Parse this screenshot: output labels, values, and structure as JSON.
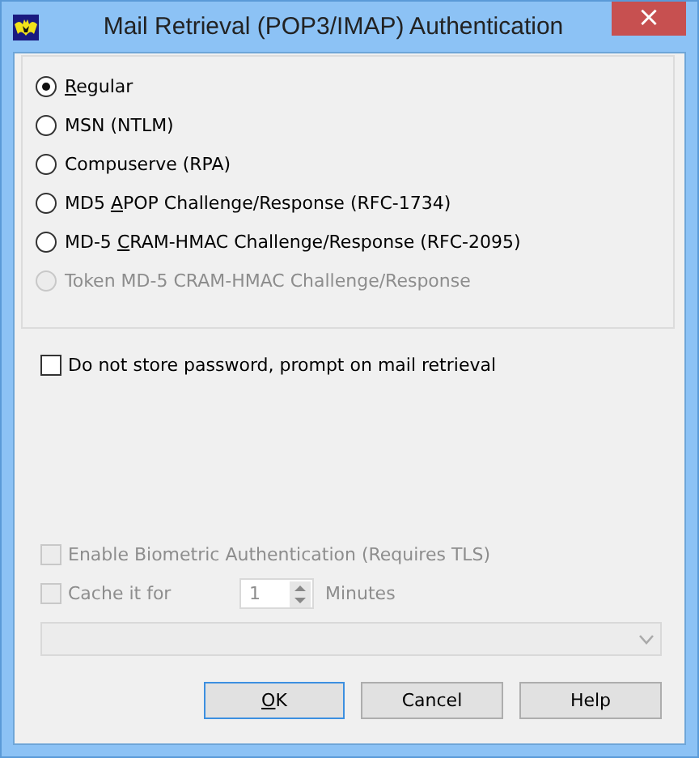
{
  "window": {
    "title": "Mail Retrieval (POP3/IMAP) Authentication",
    "close": "×"
  },
  "methods": [
    {
      "key": "R",
      "after": "egular",
      "selected": true,
      "disabled": false
    },
    {
      "before": "MSN (NTLM)",
      "selected": false,
      "disabled": false
    },
    {
      "before": "Compuserve (RPA)",
      "selected": false,
      "disabled": false
    },
    {
      "before": "MD5 ",
      "key": "A",
      "after": "POP Challenge/Response (RFC-1734)",
      "selected": false,
      "disabled": false
    },
    {
      "before": "MD-5 ",
      "key": "C",
      "after": "RAM-HMAC Challenge/Response (RFC-2095)",
      "selected": false,
      "disabled": false
    },
    {
      "before": "Token MD-5 CRAM-HMAC Challenge/Response",
      "selected": false,
      "disabled": true
    }
  ],
  "prompt_checkbox": {
    "label": "Do not store password, prompt on mail retrieval",
    "checked": false,
    "disabled": false
  },
  "biometric_checkbox": {
    "label": "Enable Biometric Authentication (Requires TLS)",
    "checked": false,
    "disabled": true
  },
  "cache": {
    "label": "Cache it for",
    "checked": false,
    "disabled": true,
    "value": "1",
    "unit": "Minutes"
  },
  "combo": {
    "disabled": true
  },
  "buttons": [
    {
      "key": "O",
      "after": "K",
      "default": true
    },
    {
      "before": "Cancel",
      "default": false
    },
    {
      "before": "Help",
      "default": false
    }
  ]
}
